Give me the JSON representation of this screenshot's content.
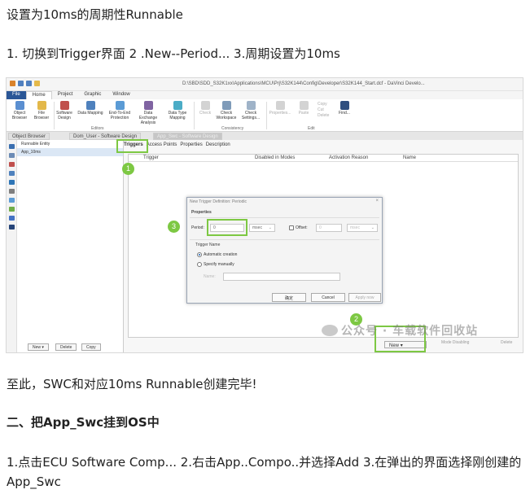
{
  "article": {
    "heading": "设置为10ms的周期性Runnable",
    "steps1": "1. 切换到Trigger界面    2 .New--Period...    3.周期设置为10ms",
    "done": "至此，SWC和对应10ms Runnable创建完毕!",
    "section2": "二、把App_Swc挂到OS中",
    "steps2": "1.点击ECU Software Comp...    2.右击App..Compo..并选择Add   3.在弹出的界面选择刚创建的App_Swc"
  },
  "app": {
    "title": "D:\\SBD\\SDD_S32K1xx\\Applications\\MCU\\Prj\\S32K144\\Config\\Developer\\S32K144_Start.dcf - DaVinci Develo...",
    "ribbon_tabs": [
      "File",
      "Home",
      "Project",
      "Graphic",
      "Window"
    ],
    "ribbon": {
      "object_browser": "Object\nBrowser",
      "file_browser": "File\nBrowser",
      "software_design": "Software\nDesign",
      "data_mapping": "Data Mapping",
      "e2e": "End-To-End\nProtection",
      "data_exchange": "Data Exchange\nAnalysis",
      "data_type_mapping": "Data Type\nMapping",
      "check": "Check",
      "check_workspace": "Check\nWorkspace",
      "check_settings": "Check\nSettings...",
      "properties": "Properties...",
      "paste": "Paste",
      "copy": "Copy",
      "cut": "Cut",
      "delete": "Delete",
      "find": "Find...",
      "group_editors": "Editors",
      "group_consistency": "Consistency",
      "group_edit": "Edit"
    },
    "doc_tabs": [
      "Object Browser",
      "Dom_User - Software Design",
      "App_Swc - Software Design"
    ],
    "left_panel": {
      "header": "Runnable Entity",
      "item": "App_10ms",
      "new": "New",
      "delete": "Delete",
      "copy": "Copy"
    },
    "sub_tabs": [
      "Triggers",
      "Access Points",
      "Properties",
      "Description"
    ],
    "grid_headers": [
      "Trigger",
      "Disabled in Modes",
      "Activation Reason",
      "Name"
    ],
    "new_button": "New",
    "bottom_extra": "Mode Disabling",
    "bottom_delete": "Delete"
  },
  "dialog": {
    "title": "New Trigger Definition: Periodic",
    "properties": "Properties",
    "period_label": "Period:",
    "period_value": "0",
    "period_unit": "msec",
    "offset_label": "Offset:",
    "offset_value": "0",
    "offset_unit": "msec",
    "trigger_name": "Trigger Name",
    "auto": "Automatic creation",
    "manual": "Specify manually",
    "name_label": "Name:",
    "ok": "确定",
    "cancel": "Cancel",
    "apply": "Apply now"
  },
  "annotations": [
    "1",
    "2",
    "3"
  ],
  "watermark": "公众号 · 车载软件回收站",
  "colors": {
    "accent": "#7dc843",
    "file_tab": "#2b5797"
  }
}
